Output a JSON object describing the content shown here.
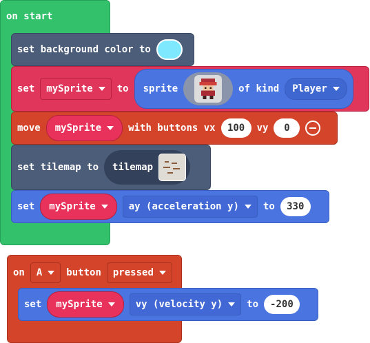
{
  "on_start": {
    "label": "on start",
    "set_background": {
      "label": "set background color to",
      "color": "#7ee8ff"
    },
    "set_sprite": {
      "set_label": "set",
      "variable": "mySprite",
      "to_label": "to",
      "sprite_label": "sprite",
      "of_kind_label": "of kind",
      "kind": "Player"
    },
    "move": {
      "move_label": "move",
      "variable": "mySprite",
      "with_buttons_label": "with buttons vx",
      "vx": "100",
      "vy_label": "vy",
      "vy": "0"
    },
    "set_tilemap": {
      "label": "set tilemap to",
      "tilemap_label": "tilemap"
    },
    "set_accel": {
      "set_label": "set",
      "variable": "mySprite",
      "property": "ay (acceleration y)",
      "to_label": "to",
      "value": "330"
    }
  },
  "on_button": {
    "on_label": "on",
    "button_name": "A",
    "button_label": "button",
    "event": "pressed",
    "set_velocity": {
      "set_label": "set",
      "variable": "mySprite",
      "property": "vy (velocity y)",
      "to_label": "to",
      "value": "-200"
    }
  },
  "colors": {
    "loops_green": "#33c26b",
    "scene_slate": "#4b5d79",
    "sprites_pink": "#e0365c",
    "controller_orange": "#d4442a",
    "sprite_blue": "#4a74e0"
  }
}
